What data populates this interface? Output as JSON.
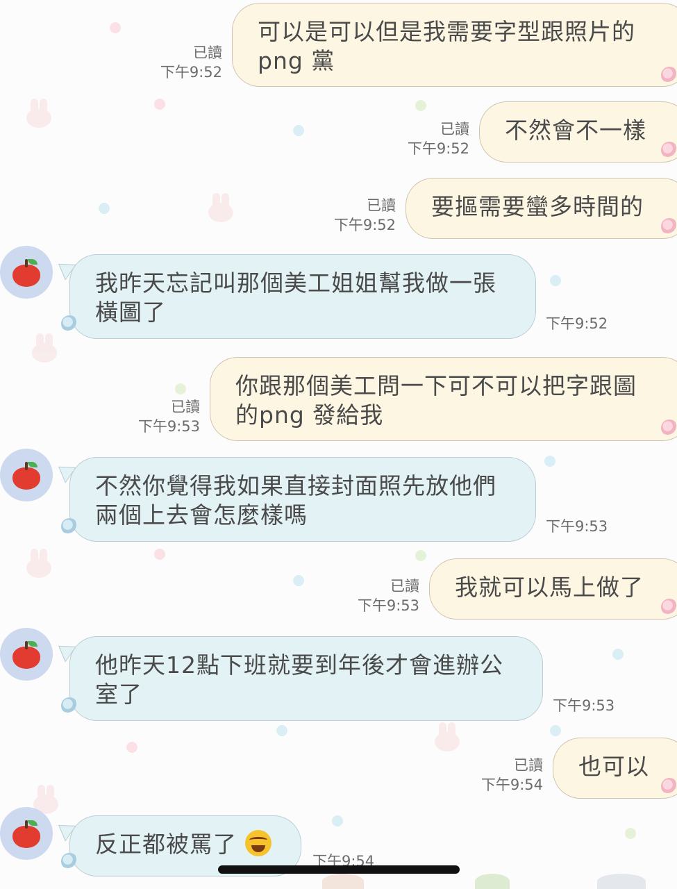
{
  "theme": {
    "outgoing_bubble": "#fdf6e3",
    "incoming_bubble": "#e2f2f5",
    "avatar_bg": "#ccd9ee"
  },
  "messages": [
    {
      "dir": "out",
      "text": "可以是可以但是我需要字型跟照片的\npng 黨",
      "read": "已讀",
      "time": "下午9:52"
    },
    {
      "dir": "out",
      "text": "不然會不一樣",
      "read": "已讀",
      "time": "下午9:52"
    },
    {
      "dir": "out",
      "text": "要摳需要蠻多時間的",
      "read": "已讀",
      "time": "下午9:52"
    },
    {
      "dir": "in",
      "text": "我昨天忘記叫那個美工姐姐幫我做一張\n橫圖了",
      "time": "下午9:52",
      "avatar_icon": "apple-icon"
    },
    {
      "dir": "out",
      "text": "你跟那個美工問一下可不可以把字跟圖\n的png 發給我",
      "read": "已讀",
      "time": "下午9:53"
    },
    {
      "dir": "in",
      "text": "不然你覺得我如果直接封面照先放他們\n兩個上去會怎麼樣嗎",
      "time": "下午9:53",
      "avatar_icon": "apple-icon"
    },
    {
      "dir": "out",
      "text": "我就可以馬上做了",
      "read": "已讀",
      "time": "下午9:53"
    },
    {
      "dir": "in",
      "text": "他昨天12點下班就要到年後才會進辦公\n室了",
      "time": "下午9:53",
      "avatar_icon": "apple-icon"
    },
    {
      "dir": "out",
      "text": "也可以",
      "read": "已讀",
      "time": "下午9:54"
    },
    {
      "dir": "in",
      "text": "反正都被罵了",
      "emoji": "laughing-tears-emoji",
      "time": "下午9:54",
      "avatar_icon": "apple-icon"
    }
  ]
}
